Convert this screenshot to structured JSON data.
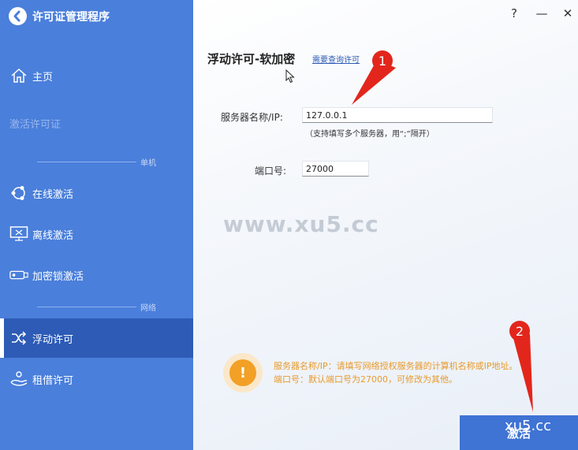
{
  "app": {
    "title": "许可证管理程序"
  },
  "window": {
    "help": "?",
    "minimize": "—",
    "close": "✕"
  },
  "sidebar": {
    "home": "主页",
    "activate_license": "激活许可证",
    "section_standalone": "单机",
    "online_activation": "在线激活",
    "offline_activation": "离线激活",
    "dongle_activation": "加密锁激活",
    "section_network": "网络",
    "floating_license": "浮动许可",
    "borrow_license": "租借许可"
  },
  "main": {
    "title": "浮动许可-软加密",
    "query_link": "需要查询许可",
    "server_label": "服务器名称/IP:",
    "server_value": "127.0.0.1",
    "server_hint": "（支持填写多个服务器，用“;”隔开）",
    "port_label": "端口号:",
    "port_value": "27000",
    "info_line1": "服务器名称/IP：请填写网络授权服务器的计算机名称或IP地址。",
    "info_line2": "端口号：默认端口号为27000，可修改为其他。",
    "activate_button": "激活"
  },
  "overlay": {
    "watermark": "www.xu5.cc",
    "watermark_corner": "xu5.cc",
    "badge1": "1",
    "badge2": "2",
    "accent_color": "#e3261c"
  },
  "colors": {
    "sidebar": "#4a7fdb",
    "sidebar_active": "#2d5bb5",
    "info": "#f2a026"
  }
}
